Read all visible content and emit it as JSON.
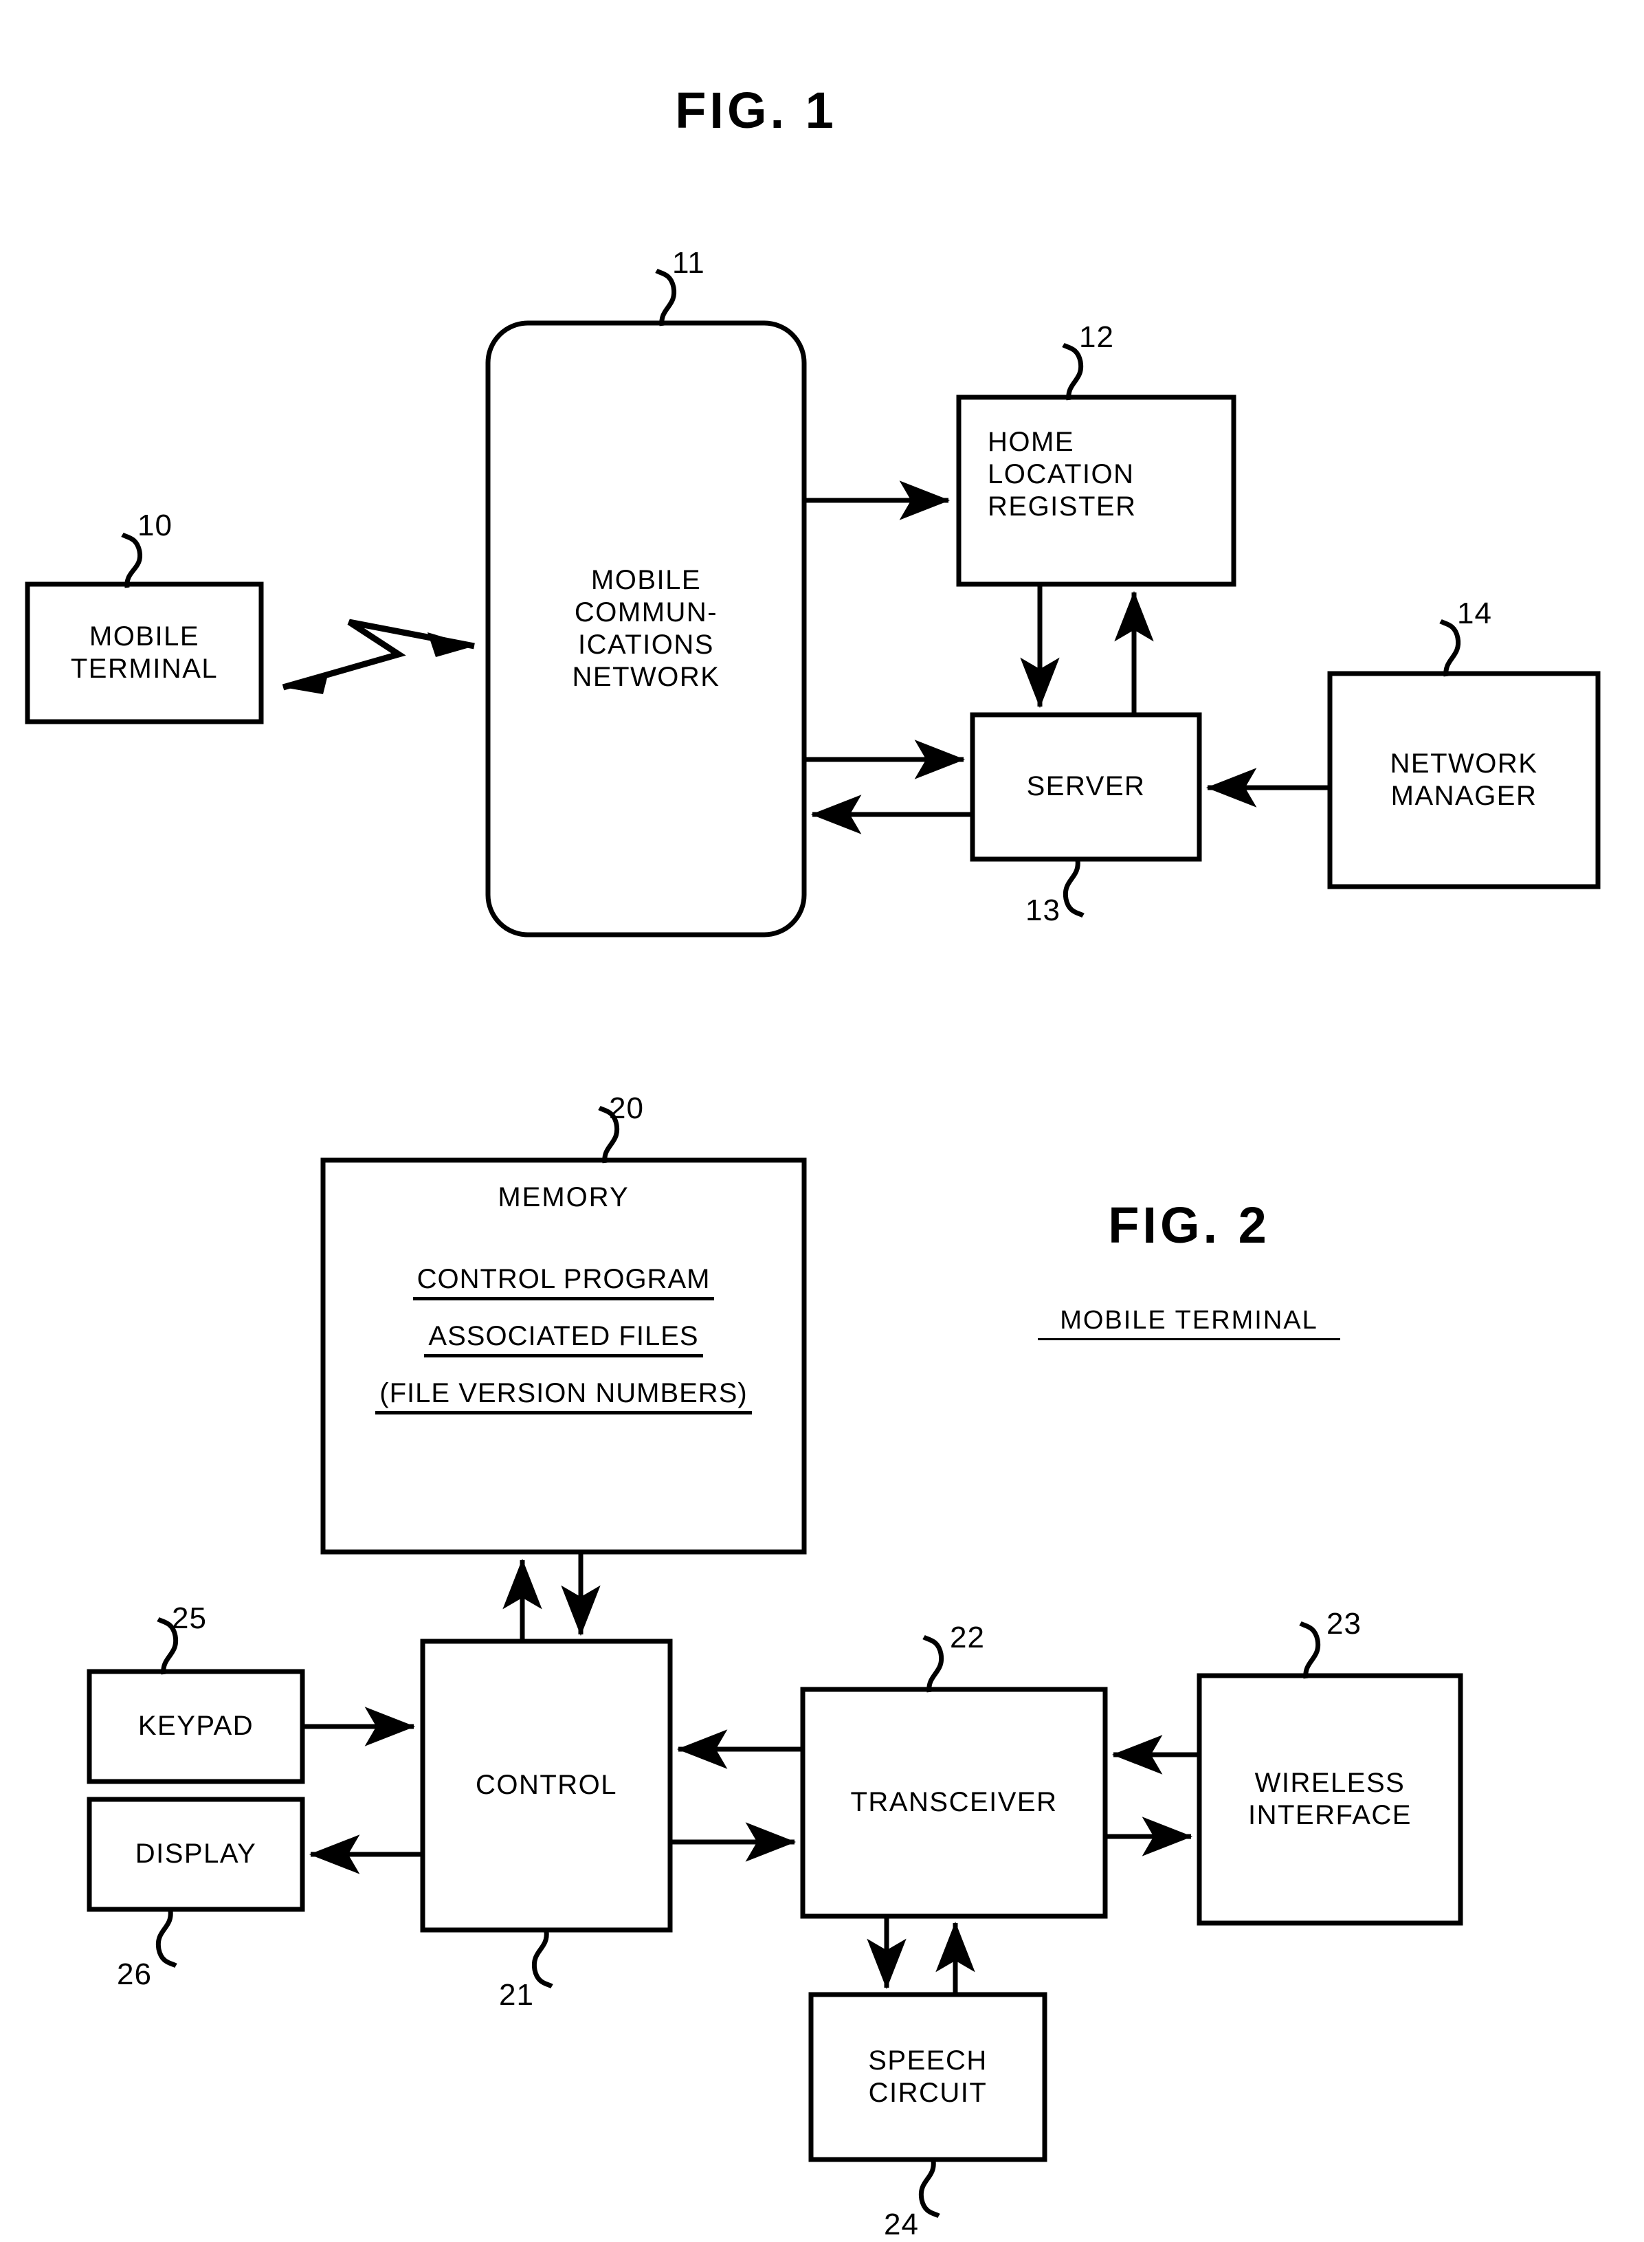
{
  "page": {
    "background": "#ffffff",
    "ink": "#000000"
  },
  "figures": [
    {
      "id": "fig1",
      "title": "FIG. 1",
      "subtitle": "",
      "nodes": [
        {
          "key": "mobile_terminal",
          "ref": "10",
          "lines": [
            "MOBILE",
            "TERMINAL"
          ],
          "shape": "rect"
        },
        {
          "key": "mobile_comm_network",
          "ref": "11",
          "lines": [
            "MOBILE",
            "COMMUN-",
            "ICATIONS",
            "NETWORK"
          ],
          "shape": "rounded"
        },
        {
          "key": "home_location_register",
          "ref": "12",
          "lines": [
            "HOME",
            "LOCATION",
            "REGISTER"
          ],
          "shape": "rect"
        },
        {
          "key": "server",
          "ref": "13",
          "lines": [
            "SERVER"
          ],
          "shape": "rect"
        },
        {
          "key": "network_manager",
          "ref": "14",
          "lines": [
            "NETWORK",
            "MANAGER"
          ],
          "shape": "rect"
        }
      ],
      "edges": [
        {
          "from": "mobile_terminal",
          "to": "mobile_comm_network",
          "style": "wireless-zigzag",
          "arrows": "both"
        },
        {
          "from": "mobile_comm_network",
          "to": "home_location_register",
          "style": "line",
          "arrows": "to"
        },
        {
          "from": "home_location_register",
          "to": "server",
          "style": "line",
          "arrows": "to"
        },
        {
          "from": "server",
          "to": "home_location_register",
          "style": "line",
          "arrows": "to"
        },
        {
          "from": "mobile_comm_network",
          "to": "server",
          "style": "line",
          "arrows": "to"
        },
        {
          "from": "server",
          "to": "mobile_comm_network",
          "style": "line",
          "arrows": "to"
        },
        {
          "from": "network_manager",
          "to": "server",
          "style": "line",
          "arrows": "to"
        }
      ]
    },
    {
      "id": "fig2",
      "title": "FIG. 2",
      "subtitle": "MOBILE TERMINAL",
      "nodes": [
        {
          "key": "memory",
          "ref": "20",
          "lines": [
            "MEMORY"
          ],
          "shape": "rect",
          "contents": [
            "CONTROL PROGRAM",
            "ASSOCIATED FILES",
            "(FILE VERSION NUMBERS)"
          ]
        },
        {
          "key": "control",
          "ref": "21",
          "lines": [
            "CONTROL"
          ],
          "shape": "rect"
        },
        {
          "key": "transceiver",
          "ref": "22",
          "lines": [
            "TRANSCEIVER"
          ],
          "shape": "rect"
        },
        {
          "key": "wireless_interface",
          "ref": "23",
          "lines": [
            "WIRELESS",
            "INTERFACE"
          ],
          "shape": "rect"
        },
        {
          "key": "speech_circuit",
          "ref": "24",
          "lines": [
            "SPEECH",
            "CIRCUIT"
          ],
          "shape": "rect"
        },
        {
          "key": "keypad",
          "ref": "25",
          "lines": [
            "KEYPAD"
          ],
          "shape": "rect"
        },
        {
          "key": "display",
          "ref": "26",
          "lines": [
            "DISPLAY"
          ],
          "shape": "rect"
        }
      ],
      "edges": [
        {
          "from": "control",
          "to": "memory",
          "style": "line",
          "arrows": "to"
        },
        {
          "from": "memory",
          "to": "control",
          "style": "line",
          "arrows": "to"
        },
        {
          "from": "keypad",
          "to": "control",
          "style": "line",
          "arrows": "to"
        },
        {
          "from": "control",
          "to": "display",
          "style": "line",
          "arrows": "to"
        },
        {
          "from": "transceiver",
          "to": "control",
          "style": "line",
          "arrows": "to"
        },
        {
          "from": "control",
          "to": "transceiver",
          "style": "line",
          "arrows": "to"
        },
        {
          "from": "wireless_interface",
          "to": "transceiver",
          "style": "line",
          "arrows": "to"
        },
        {
          "from": "transceiver",
          "to": "wireless_interface",
          "style": "line",
          "arrows": "to"
        },
        {
          "from": "transceiver",
          "to": "speech_circuit",
          "style": "line",
          "arrows": "to"
        },
        {
          "from": "speech_circuit",
          "to": "transceiver",
          "style": "line",
          "arrows": "to"
        }
      ]
    }
  ],
  "fig1": {
    "title": "FIG. 1",
    "mobile_terminal": {
      "line1": "MOBILE",
      "line2": "TERMINAL",
      "ref": "10"
    },
    "network": {
      "line1": "MOBILE",
      "line2": "COMMUN-",
      "line3": "ICATIONS",
      "line4": "NETWORK",
      "ref": "11"
    },
    "hlr": {
      "line1": "HOME",
      "line2": "LOCATION",
      "line3": "REGISTER",
      "ref": "12"
    },
    "server": {
      "line1": "SERVER",
      "ref": "13"
    },
    "network_manager": {
      "line1": "NETWORK",
      "line2": "MANAGER",
      "ref": "14"
    }
  },
  "fig2": {
    "title": "FIG. 2",
    "subtitle": "MOBILE TERMINAL",
    "memory": {
      "title": "MEMORY",
      "item1": "CONTROL PROGRAM",
      "item2": "ASSOCIATED FILES",
      "item3": "(FILE VERSION NUMBERS)",
      "ref": "20"
    },
    "control": {
      "line1": "CONTROL",
      "ref": "21"
    },
    "transceiver": {
      "line1": "TRANSCEIVER",
      "ref": "22"
    },
    "wireless_interface": {
      "line1": "WIRELESS",
      "line2": "INTERFACE",
      "ref": "23"
    },
    "speech_circuit": {
      "line1": "SPEECH",
      "line2": "CIRCUIT",
      "ref": "24"
    },
    "keypad": {
      "line1": "KEYPAD",
      "ref": "25"
    },
    "display": {
      "line1": "DISPLAY",
      "ref": "26"
    }
  }
}
